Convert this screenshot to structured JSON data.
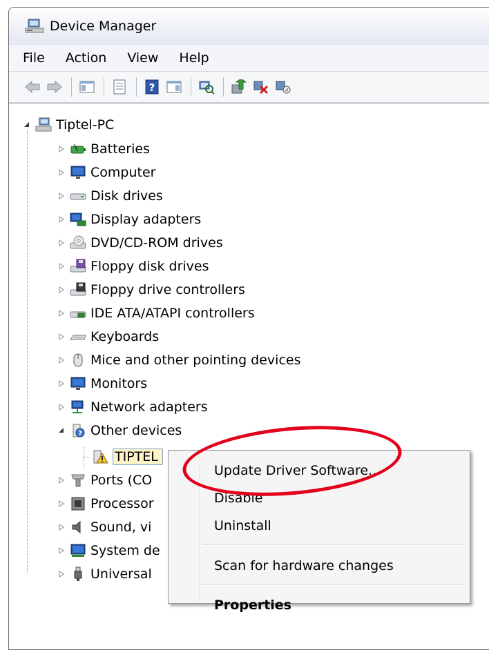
{
  "window": {
    "title": "Device Manager"
  },
  "menu": [
    "File",
    "Action",
    "View",
    "Help"
  ],
  "toolbar_icons": [
    "back-arrow-icon",
    "forward-arrow-icon",
    "show-hide-console-tree-icon",
    "properties-sheet-icon",
    "help-icon",
    "action-pane-icon",
    "scan-hardware-icon",
    "update-driver-icon",
    "uninstall-icon",
    "disable-icon"
  ],
  "tree": {
    "root": "Tiptel-PC",
    "categories": [
      "Batteries",
      "Computer",
      "Disk drives",
      "Display adapters",
      "DVD/CD-ROM drives",
      "Floppy disk drives",
      "Floppy drive controllers",
      "IDE ATA/ATAPI controllers",
      "Keyboards",
      "Mice and other pointing devices",
      "Monitors",
      "Network adapters",
      "Other devices"
    ],
    "selected_device": "TIPTEL",
    "more_categories": [
      "Ports (CO",
      "Processor",
      "Sound, vi",
      "System de",
      "Universal"
    ]
  },
  "context_menu": {
    "update": "Update Driver Software...",
    "disable": "Disable",
    "uninstall": "Uninstall",
    "scan": "Scan for hardware changes",
    "properties": "Properties"
  },
  "colors": {
    "annotation": "#e3001b",
    "selection_fill": "#fdf3c9"
  }
}
